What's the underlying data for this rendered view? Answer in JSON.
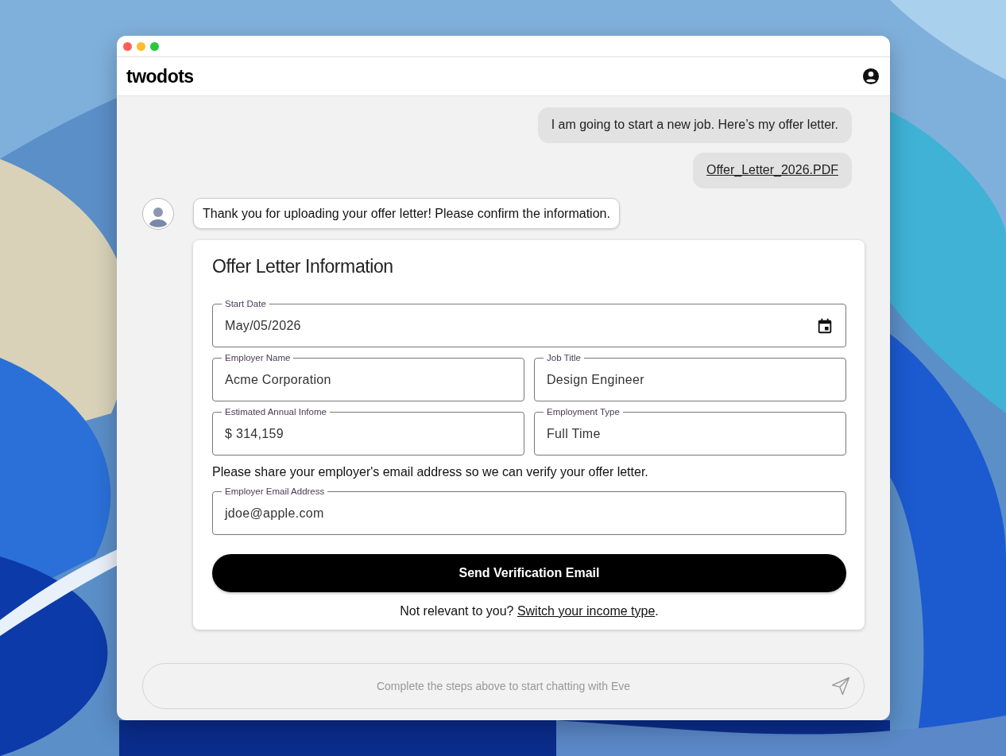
{
  "header": {
    "logo": "twodots"
  },
  "messages": [
    {
      "kind": "user_text",
      "text": "I am going to start a new job. Here’s my offer letter."
    },
    {
      "kind": "user_file",
      "text": "Offer_Letter_2026.PDF"
    },
    {
      "kind": "bot_text",
      "text": "Thank you for uploading your offer letter! Please confirm the information."
    }
  ],
  "form": {
    "title": "Offer Letter Information",
    "rows": [
      [
        {
          "label": "Start Date",
          "value": "May/05/2026",
          "kind": "date"
        }
      ],
      [
        {
          "label": "Employer Name",
          "value": "Acme Corporation",
          "kind": "text"
        },
        {
          "label": "Job Title",
          "value": "Design Engineer",
          "kind": "text"
        }
      ],
      [
        {
          "label": "Estimated Annual Infome",
          "value": "$ 314,159",
          "kind": "text"
        },
        {
          "label": "Employment Type",
          "value": "Full Time",
          "kind": "text"
        }
      ]
    ],
    "email_prompt": "Please share your employer's email address so we can verify your offer letter.",
    "email_field": {
      "label": "Employer Email Address",
      "value": "jdoe@apple.com"
    },
    "submit_button": "Send Verification Email",
    "footer_text": "Not relevant to you?",
    "footer_link": "Switch your income type",
    "footer_end": "."
  },
  "chat_input": {
    "placeholder": "Complete the steps above to start chatting with Eve",
    "disabled": true
  }
}
